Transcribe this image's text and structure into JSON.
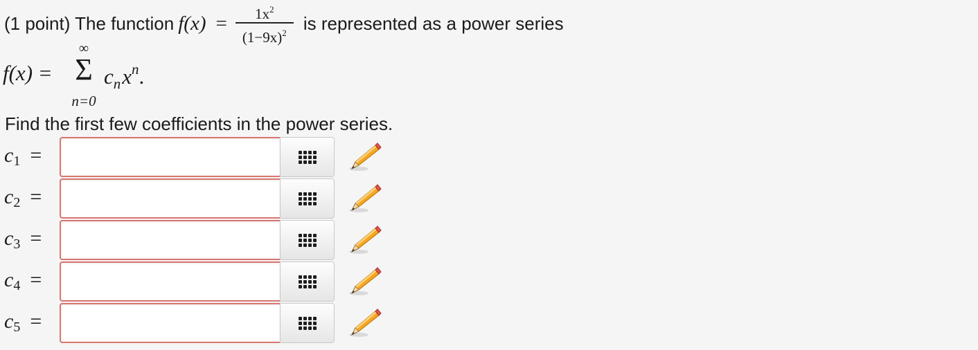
{
  "question": {
    "points_prefix": "(1 point) The function",
    "function_symbol": "f(x)",
    "equals": "=",
    "numerator_base": "1x",
    "numerator_exp": "2",
    "denominator_base": "(1−9x)",
    "denominator_exp": "2",
    "suffix": "is represented as a power series"
  },
  "series": {
    "lhs": "f(x) =",
    "upper": "∞",
    "sigma": "Σ",
    "lower": "n=0",
    "term_c": "c",
    "term_c_sub": "n",
    "term_x": "x",
    "term_x_exp": "n",
    "period": "."
  },
  "instruction": "Find the first few coefficients in the power series.",
  "answers": [
    {
      "var": "c",
      "sub": "1",
      "equals": "=",
      "value": ""
    },
    {
      "var": "c",
      "sub": "2",
      "equals": "=",
      "value": ""
    },
    {
      "var": "c",
      "sub": "3",
      "equals": "=",
      "value": ""
    },
    {
      "var": "c",
      "sub": "4",
      "equals": "=",
      "value": ""
    },
    {
      "var": "c",
      "sub": "5",
      "equals": "=",
      "value": ""
    }
  ],
  "icons": {
    "keyboard": "equation-editor-grid-icon",
    "pencil": "pencil-icon"
  },
  "colors": {
    "background": "#f5f5f5",
    "input_border_error": "#d9756f",
    "pencil_body": "#f5a623",
    "pencil_tip": "#e8574f"
  }
}
